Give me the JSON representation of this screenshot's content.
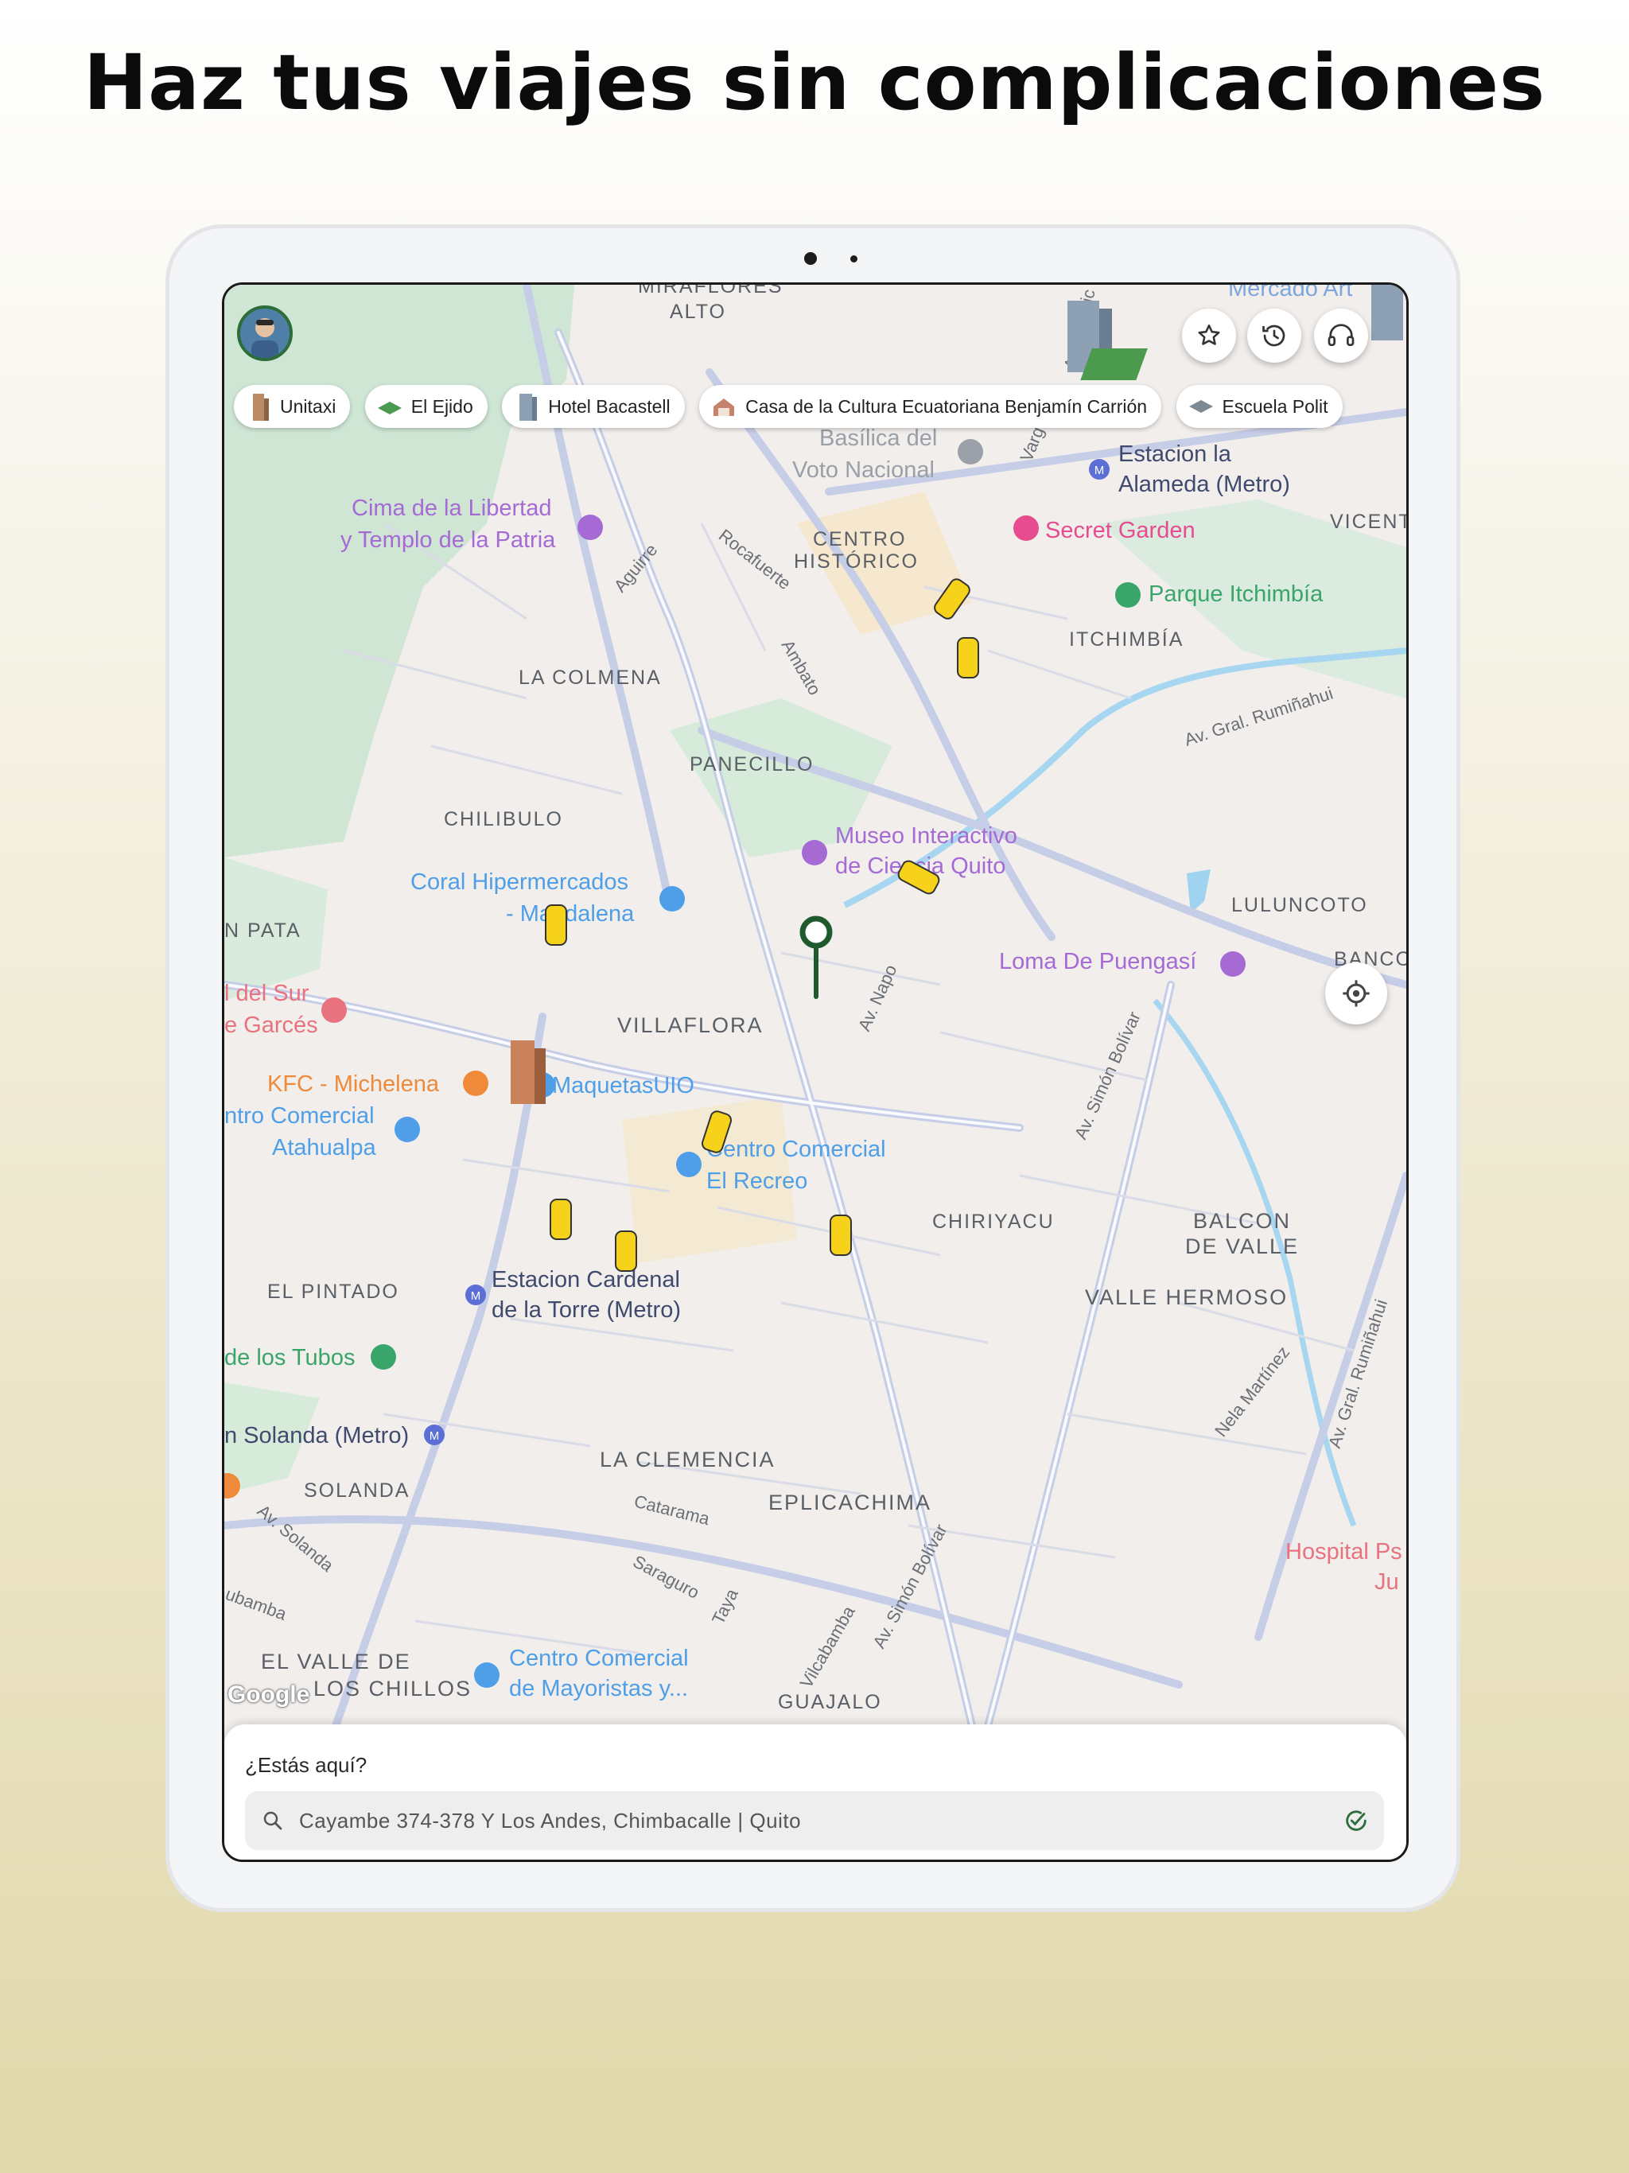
{
  "headline": "Haz tus viajes sin complicaciones",
  "colors": {
    "accent": "#2c6d3a",
    "taxi": "#f7d21b",
    "metro": "#5b6fd6",
    "poi_purple": "#a56ad4",
    "poi_pink": "#e64c8f"
  },
  "toolbar": {
    "favorites_icon": "star-icon",
    "history_icon": "history-icon",
    "support_icon": "headset-icon"
  },
  "chips": [
    {
      "label": "Unitaxi"
    },
    {
      "label": "El Ejido"
    },
    {
      "label": "Hotel Bacastell"
    },
    {
      "label": "Casa de la Cultura Ecuatoriana Benjamín Carrión"
    },
    {
      "label": "Escuela Polit"
    }
  ],
  "map_labels": {
    "miraflores": "MIRAFLORES",
    "alto": "ALTO",
    "mercado": "Mercado Art",
    "basilica_1": "Basílica del",
    "basilica_2": "Voto Nacional",
    "alameda_1": "Estacion la",
    "alameda_2": "Alameda (Metro)",
    "cima_1": "Cima de la Libertad",
    "cima_2": "y Templo de la Patria",
    "centro_1": "CENTRO",
    "centro_2": "HISTÓRICO",
    "secret_garden": "Secret Garden",
    "vicente": "VICENT",
    "parque_itchimbia": "Parque Itchimbía",
    "itchimbia": "ITCHIMBÍA",
    "la_colmena": "LA COLMENA",
    "panecillo": "PANECILLO",
    "chilibulo": "CHILIBULO",
    "museo_1": "Museo Interactivo",
    "museo_2": "de Ciencia Quito",
    "coral_1": "Coral Hipermercados",
    "coral_2": "- Magdalena",
    "lulunocoto": "LULUNCOTO",
    "loma": "Loma De Puengasí",
    "pata": "N PATA",
    "banco": "BANCO",
    "sur_1": "l del Sur",
    "sur_2": "e Garcés",
    "villaflora": "VILLAFLORA",
    "kfc": "KFC - Michelena",
    "maquetas": "MaquetasUIO",
    "atahualpa_1": "ntro Comercial",
    "atahualpa_2": "Atahualpa",
    "recreo_1": "Centro Comercial",
    "recreo_2": "El Recreo",
    "chiriyacu": "CHIRIYACU",
    "balcon_1": "BALCON",
    "balcon_2": "DE VALLE",
    "el_pintado": "EL PINTADO",
    "cardenal_1": "Estacion Cardenal",
    "cardenal_2": "de la Torre (Metro)",
    "valle_hermoso": "VALLE HERMOSO",
    "tubos": "de los Tubos",
    "solanda_metro": "n Solanda (Metro)",
    "la_clemencia": "LA CLEMENCIA",
    "solanda": "SOLANDA",
    "eplicachima": "EPLICACHIMA",
    "hospital_1": "Hospital Ps",
    "hospital_2": "Ju",
    "valle_chillos_1": "EL VALLE DE",
    "valle_chillos_2": "LOS CHILLOS",
    "mayoristas_1": "Centro Comercial",
    "mayoristas_2": "de Mayoristas y...",
    "guajalo": "GUAJALO"
  },
  "streets": {
    "rocafuerte": "Rocafuerte",
    "ambato": "Ambato",
    "aguirre": "Aguirre",
    "vargas": "Varg",
    "av_america": "Av. Améric",
    "av_gral_ruminahui": "Av. Gral. Rumiñahui",
    "av_napo": "Av. Napo",
    "av_simon_bolivar": "Av. Simón Bolívar",
    "nela_martinez": "Nela Martínez",
    "catarama": "Catarama",
    "saraguro": "Saraguro",
    "taya": "Taya",
    "vilcabamba": "Vilcabamba",
    "av_solanda": "Av. Solanda",
    "av_simon_bolivar_2": "Av. Simón Bolívar",
    "av_gral_ruminahui_2": "Av. Gral. Rumiñahui",
    "tubamba": "ubamba"
  },
  "google_logo": "Google",
  "bottom_sheet": {
    "title": "¿Estás aquí?",
    "address": "Cayambe 374-378 Y Los Andes, Chimbacalle | Quito",
    "search_icon": "search-icon",
    "confirm_icon": "check-circle-icon"
  }
}
